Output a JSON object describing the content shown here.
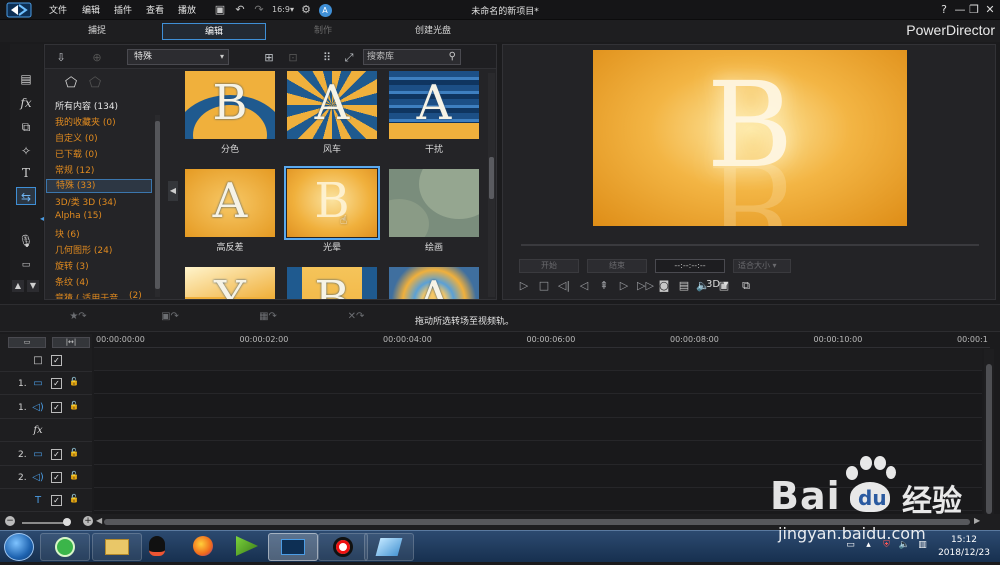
{
  "menu": [
    "文件",
    "编辑",
    "插件",
    "查看",
    "播放"
  ],
  "doc_title": "未命名的新项目*",
  "brand": "PowerDirector",
  "mode_tabs": [
    {
      "label": "捕捉",
      "state": "normal"
    },
    {
      "label": "编辑",
      "state": "active"
    },
    {
      "label": "制作",
      "state": "disabled"
    },
    {
      "label": "创建光盘",
      "state": "normal"
    }
  ],
  "window_buttons": [
    "?",
    "—",
    "❐",
    "✕"
  ],
  "library": {
    "filter_value": "特殊",
    "search_placeholder": "搜索库",
    "categories": [
      {
        "label": "所有内容 (134)",
        "style": "white"
      },
      {
        "label": "我的收藏夹 (0)",
        "style": "orange"
      },
      {
        "label": "自定义 (0)",
        "style": "orange"
      },
      {
        "label": "已下载 (0)",
        "style": "orange"
      },
      {
        "label": "常规 (12)",
        "style": "orange"
      },
      {
        "label": "特殊 (33)",
        "style": "selected"
      },
      {
        "label": "3D/类 3D (34)",
        "style": "orange"
      },
      {
        "label": "Alpha (15)",
        "style": "orange"
      },
      {
        "label": "块 (6)",
        "style": "orange"
      },
      {
        "label": "几何图形 (24)",
        "style": "orange"
      },
      {
        "label": "旋转 (3)",
        "style": "orange"
      },
      {
        "label": "条纹 (4)",
        "style": "orange"
      },
      {
        "label": "竞猜 ( 适用于音",
        "style": "orange"
      }
    ],
    "category_partial_count": "(2)",
    "thumbnails": [
      {
        "label": "分色",
        "letter": "B",
        "kind": "split"
      },
      {
        "label": "风车",
        "letter": "A",
        "kind": "windmill"
      },
      {
        "label": "干扰",
        "letter": "A",
        "kind": "noise"
      },
      {
        "label": "高反差",
        "letter": "A",
        "kind": "contrast"
      },
      {
        "label": "光晕",
        "letter": "B",
        "kind": "glow",
        "selected": true
      },
      {
        "label": "绘画",
        "letter": "",
        "kind": "paint"
      },
      {
        "label": "",
        "letter": "Y",
        "kind": "row3a"
      },
      {
        "label": "",
        "letter": "B",
        "kind": "row3b"
      },
      {
        "label": "",
        "letter": "A",
        "kind": "row3c"
      }
    ]
  },
  "preview": {
    "letter": "B",
    "btn_start": "开始",
    "btn_end": "结束",
    "timecode": "--:--:--:--",
    "fit_label": "适合大小",
    "mode_3d": "3D"
  },
  "timeline": {
    "hint": "拖动所选转场至视频轨。",
    "ruler": [
      "00:00:00:00",
      "00:00:02:00",
      "00:00:04:00",
      "00:00:06:00",
      "00:00:08:00",
      "00:00:10:00",
      "00:00:1"
    ],
    "tracks": [
      {
        "num": "",
        "icon": "square",
        "kind": "master"
      },
      {
        "num": "1.",
        "icon": "video",
        "kind": "video"
      },
      {
        "num": "1.",
        "icon": "audio",
        "kind": "audio"
      },
      {
        "num": "",
        "icon": "fx",
        "kind": "fx"
      },
      {
        "num": "2.",
        "icon": "video",
        "kind": "video"
      },
      {
        "num": "2.",
        "icon": "audio",
        "kind": "audio"
      },
      {
        "num": "",
        "icon": "title",
        "kind": "title"
      }
    ]
  },
  "taskbar": {
    "time": "15:12",
    "date": "2018/12/23"
  },
  "watermark": {
    "brand": "Bai",
    "brand2": "经验",
    "url": "jingyan.baidu.com"
  },
  "colors": {
    "accent": "#3f8fd6",
    "category_orange": "#e08a1f",
    "transition_gold": "#f0b03c",
    "transition_blue": "#1f5a8f"
  }
}
